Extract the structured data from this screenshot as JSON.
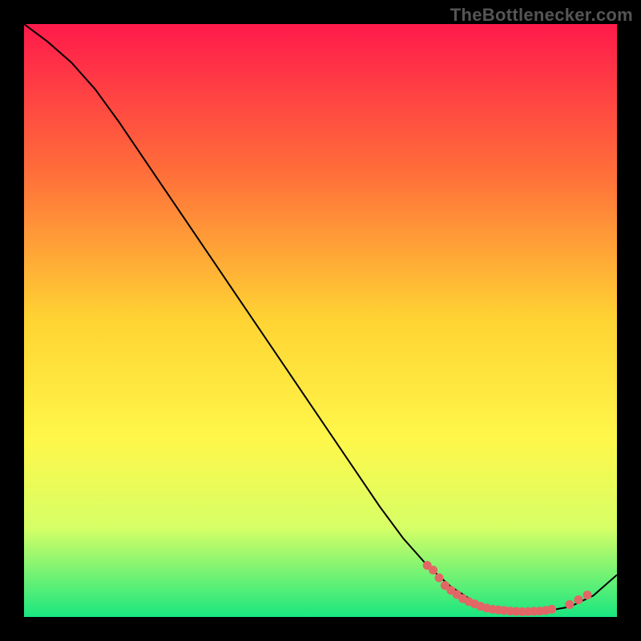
{
  "watermark": "TheBottlenecker.com",
  "chart_data": {
    "type": "line",
    "title": "",
    "xlabel": "",
    "ylabel": "",
    "xlim": [
      0,
      100
    ],
    "ylim": [
      0,
      100
    ],
    "grid": false,
    "background_gradient": {
      "stops": [
        {
          "offset": 0,
          "color": "#ff1a4b"
        },
        {
          "offset": 25,
          "color": "#ff6e3a"
        },
        {
          "offset": 50,
          "color": "#ffd433"
        },
        {
          "offset": 70,
          "color": "#fff74a"
        },
        {
          "offset": 85,
          "color": "#d6ff66"
        },
        {
          "offset": 100,
          "color": "#19e680"
        }
      ]
    },
    "series": [
      {
        "name": "bottleneck-curve",
        "color": "#000000",
        "x": [
          0,
          4,
          8,
          12,
          16,
          20,
          24,
          28,
          32,
          36,
          40,
          44,
          48,
          52,
          56,
          60,
          64,
          68,
          72,
          76,
          80,
          84,
          88,
          92,
          96,
          100
        ],
        "y": [
          100,
          97,
          93.5,
          89,
          83.5,
          77.6,
          71.7,
          65.8,
          59.9,
          54.0,
          48.1,
          42.2,
          36.3,
          30.4,
          24.5,
          18.6,
          13.2,
          8.7,
          5.1,
          2.5,
          1.2,
          0.9,
          1.0,
          1.7,
          3.6,
          7.1
        ]
      }
    ],
    "highlight_points": {
      "name": "sweet-spot-markers",
      "color": "#e36666",
      "points": [
        {
          "x": 68,
          "y": 8.7
        },
        {
          "x": 69,
          "y": 7.9
        },
        {
          "x": 70,
          "y": 6.6
        },
        {
          "x": 71,
          "y": 5.3
        },
        {
          "x": 72,
          "y": 4.5
        },
        {
          "x": 73,
          "y": 3.8
        },
        {
          "x": 74,
          "y": 3.1
        },
        {
          "x": 75,
          "y": 2.6
        },
        {
          "x": 76,
          "y": 2.2
        },
        {
          "x": 77,
          "y": 1.8
        },
        {
          "x": 78,
          "y": 1.5
        },
        {
          "x": 79,
          "y": 1.3
        },
        {
          "x": 80,
          "y": 1.2
        },
        {
          "x": 81,
          "y": 1.1
        },
        {
          "x": 82,
          "y": 1.0
        },
        {
          "x": 83,
          "y": 0.95
        },
        {
          "x": 84,
          "y": 0.9
        },
        {
          "x": 85,
          "y": 0.92
        },
        {
          "x": 86,
          "y": 0.96
        },
        {
          "x": 87,
          "y": 1.0
        },
        {
          "x": 88,
          "y": 1.1
        },
        {
          "x": 89,
          "y": 1.3
        },
        {
          "x": 92,
          "y": 2.1
        },
        {
          "x": 93.5,
          "y": 2.9
        },
        {
          "x": 95,
          "y": 3.7
        }
      ]
    }
  }
}
